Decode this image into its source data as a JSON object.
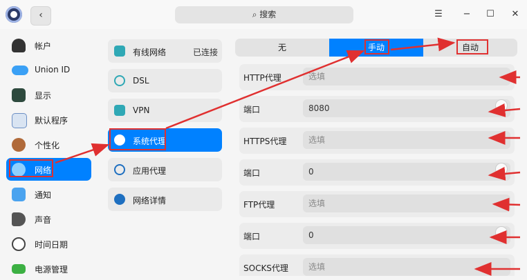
{
  "titlebar": {
    "search_placeholder": "搜索",
    "back_glyph": "‹",
    "menu_glyph": "☰",
    "minimize_glyph": "−",
    "maximize_glyph": "☐",
    "close_glyph": "✕"
  },
  "nav": {
    "items": [
      {
        "label": "帐户",
        "icon": "account-icon"
      },
      {
        "label": "Union ID",
        "icon": "cloud-icon"
      },
      {
        "label": "显示",
        "icon": "display-icon"
      },
      {
        "label": "默认程序",
        "icon": "default-apps-icon"
      },
      {
        "label": "个性化",
        "icon": "personalization-icon"
      },
      {
        "label": "网络",
        "icon": "network-icon"
      },
      {
        "label": "通知",
        "icon": "notification-icon"
      },
      {
        "label": "声音",
        "icon": "sound-icon"
      },
      {
        "label": "时间日期",
        "icon": "clock-icon"
      },
      {
        "label": "电源管理",
        "icon": "power-icon"
      }
    ],
    "active_index": 5
  },
  "network_menu": {
    "items": [
      {
        "label": "有线网络",
        "status": "已连接",
        "icon": "wired-network-icon"
      },
      {
        "label": "DSL",
        "status": "",
        "icon": "dsl-icon"
      },
      {
        "label": "VPN",
        "status": "",
        "icon": "vpn-icon"
      },
      {
        "label": "系统代理",
        "status": "",
        "icon": "system-proxy-icon"
      },
      {
        "label": "应用代理",
        "status": "",
        "icon": "app-proxy-icon"
      },
      {
        "label": "网络详情",
        "status": "",
        "icon": "info-icon"
      }
    ],
    "active_index": 3
  },
  "proxy": {
    "modes": [
      "无",
      "手动",
      "自动"
    ],
    "active_mode_index": 1,
    "rows": [
      {
        "label": "HTTP代理",
        "value": "",
        "placeholder": "选填"
      },
      {
        "label": "端口",
        "value": "8080",
        "placeholder": ""
      },
      {
        "label": "HTTPS代理",
        "value": "",
        "placeholder": "选填"
      },
      {
        "label": "端口",
        "value": "0",
        "placeholder": ""
      },
      {
        "label": "FTP代理",
        "value": "",
        "placeholder": "选填"
      },
      {
        "label": "端口",
        "value": "0",
        "placeholder": ""
      },
      {
        "label": "SOCKS代理",
        "value": "",
        "placeholder": "选填"
      }
    ]
  },
  "colors": {
    "accent": "#0081ff",
    "annotation": "#e03030",
    "panel_bg": "#ececec"
  }
}
